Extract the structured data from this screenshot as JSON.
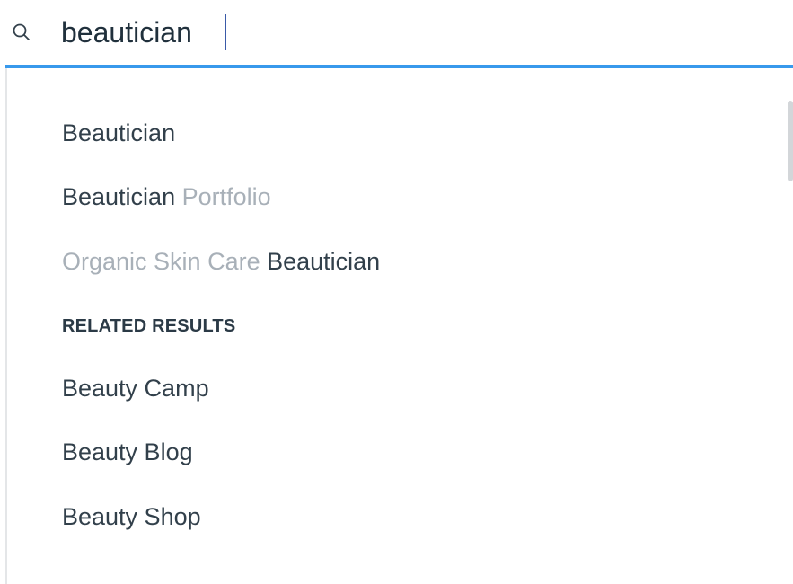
{
  "search": {
    "query": "beautician"
  },
  "suggestions": [
    {
      "prefix": "",
      "match": "Beautician",
      "suffix": ""
    },
    {
      "prefix": "",
      "match": "Beautician",
      "suffix": " Portfolio"
    },
    {
      "prefix": "Organic Skin Care ",
      "match": "Beautician",
      "suffix": ""
    }
  ],
  "related": {
    "heading": "RELATED RESULTS",
    "items": [
      "Beauty Camp",
      "Beauty Blog",
      "Beauty Shop"
    ]
  },
  "colors": {
    "accent": "#3899ec",
    "text": "#32404b",
    "muted": "#a8b0b8"
  }
}
